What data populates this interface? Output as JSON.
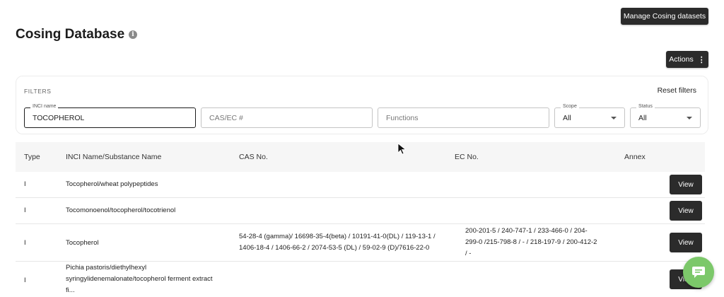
{
  "header": {
    "manage_label": "Manage Cosing datasets",
    "title": "Cosing Database",
    "info_glyph": "i",
    "actions_label": "Actions",
    "actions_glyph": "⋮"
  },
  "filters": {
    "heading": "FILTERS",
    "reset_label": "Reset filters",
    "inci": {
      "label": "INCI name",
      "value": "TOCOPHEROL"
    },
    "cas": {
      "placeholder": "CAS/EC #"
    },
    "functions": {
      "placeholder": "Functions"
    },
    "scope": {
      "label": "Scope",
      "value": "All"
    },
    "status": {
      "label": "Status",
      "value": "All"
    }
  },
  "table": {
    "columns": [
      "Type",
      "INCI Name/Substance Name",
      "CAS No.",
      "EC No.",
      "Annex"
    ],
    "view_label": "View",
    "rows": [
      {
        "type": "I",
        "name": [
          "Tocopherol/wheat polypeptides"
        ],
        "cas": [],
        "ec": []
      },
      {
        "type": "I",
        "name": [
          "Tocomonoenol/tocopherol/tocotrienol"
        ],
        "cas": [],
        "ec": []
      },
      {
        "type": "I",
        "name": [
          "Tocopherol"
        ],
        "cas": [
          "54-28-4 (gamma)/ 16698-35-4(beta) / 10191-41-0(DL) / 119-13-1 /",
          "1406-18-4 / 1406-66-2 / 2074-53-5 (DL) / 59-02-9 (D)/7616-22-0"
        ],
        "ec": [
          "200-201-5 / 240-747-1 / 233-466-0 / 204-",
          "299-0 /215-798-8 / - / 218-197-9 / 200-412-2",
          "/ -"
        ]
      },
      {
        "type": "I",
        "name": [
          "Pichia pastoris/diethylhexyl",
          "syringylidenemalonate/tocopherol ferment extract",
          "fi..."
        ],
        "cas": [],
        "ec": []
      }
    ]
  },
  "icons": {
    "info": "info-icon",
    "actions": "kebab-menu-icon",
    "chat": "chat-bubble-icon",
    "cursor": "mouse-pointer-icon"
  },
  "colors": {
    "dark_button": "#2b2b2b",
    "chat_button": "#7cc86a",
    "header_row": "#f6f6f6"
  }
}
